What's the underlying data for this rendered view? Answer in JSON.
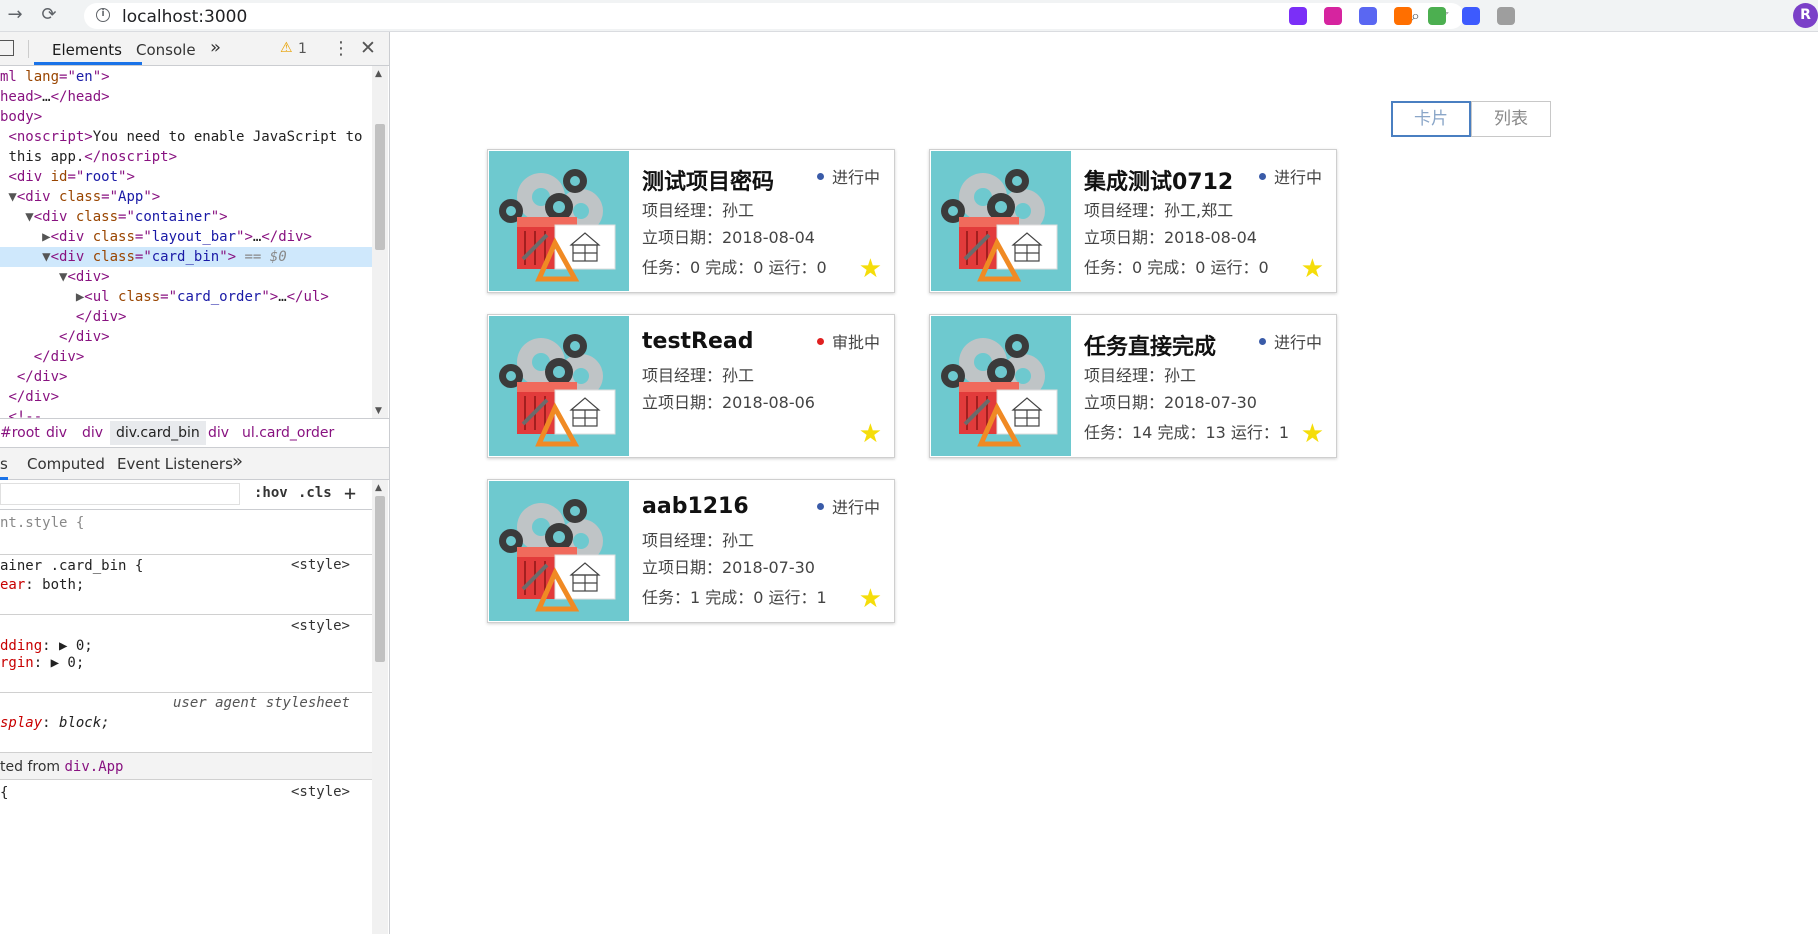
{
  "browser": {
    "url": "localhost:3000",
    "profile_initial": "R",
    "extension_colors": [
      "#7b2ff7",
      "#d6249f",
      "#5a67f2",
      "#ff6f00",
      "#4caf50",
      "#3d5afe",
      "#9e9e9e"
    ]
  },
  "devtools": {
    "tabs": [
      "Elements",
      "Console"
    ],
    "more_tabs": "»",
    "warning_count": "1",
    "tree": [
      {
        "indent": "",
        "tri": "",
        "parts": [
          [
            "tag",
            "ml "
          ],
          [
            "attr",
            "lang"
          ],
          [
            "tag",
            "=\""
          ],
          [
            "val",
            "en"
          ],
          [
            "tag",
            "\">"
          ]
        ]
      },
      {
        "indent": "",
        "tri": "",
        "parts": [
          [
            "tag",
            "head>"
          ],
          [
            "text",
            "…"
          ],
          [
            "tag",
            "</head>"
          ]
        ]
      },
      {
        "indent": "",
        "tri": "",
        "parts": [
          [
            "tag",
            "body>"
          ]
        ]
      },
      {
        "indent": " ",
        "tri": "",
        "parts": [
          [
            "tag",
            "<noscript>"
          ],
          [
            "text",
            "You need to enable JavaScript to run"
          ]
        ]
      },
      {
        "indent": " ",
        "tri": "",
        "parts": [
          [
            "text",
            "this app."
          ],
          [
            "tag",
            "</noscript>"
          ]
        ]
      },
      {
        "indent": " ",
        "tri": "",
        "parts": [
          [
            "tag",
            "<div "
          ],
          [
            "attr",
            "id"
          ],
          [
            "tag",
            "=\""
          ],
          [
            "val",
            "root"
          ],
          [
            "tag",
            "\">"
          ]
        ]
      },
      {
        "indent": "",
        "tri": " ▼",
        "parts": [
          [
            "tag",
            "<div "
          ],
          [
            "attr",
            "class"
          ],
          [
            "tag",
            "=\""
          ],
          [
            "val",
            "App"
          ],
          [
            "tag",
            "\">"
          ]
        ]
      },
      {
        "indent": "  ",
        "tri": " ▼",
        "parts": [
          [
            "tag",
            "<div "
          ],
          [
            "attr",
            "class"
          ],
          [
            "tag",
            "=\""
          ],
          [
            "val",
            "container"
          ],
          [
            "tag",
            "\">"
          ]
        ]
      },
      {
        "indent": "    ",
        "tri": " ▶",
        "parts": [
          [
            "tag",
            "<div "
          ],
          [
            "attr",
            "class"
          ],
          [
            "tag",
            "=\""
          ],
          [
            "val",
            "layout_bar"
          ],
          [
            "tag",
            "\">"
          ],
          [
            "text",
            "…"
          ],
          [
            "tag",
            "</div>"
          ]
        ]
      },
      {
        "indent": "    ",
        "tri": " ▼",
        "parts": [
          [
            "tag",
            "<div "
          ],
          [
            "attr",
            "class"
          ],
          [
            "tag",
            "=\""
          ],
          [
            "val",
            "card_bin"
          ],
          [
            "tag",
            "\">"
          ],
          [
            "eq",
            " == $0"
          ]
        ],
        "selected": true
      },
      {
        "indent": "      ",
        "tri": " ▼",
        "parts": [
          [
            "tag",
            "<div>"
          ]
        ]
      },
      {
        "indent": "        ",
        "tri": " ▶",
        "parts": [
          [
            "tag",
            "<ul "
          ],
          [
            "attr",
            "class"
          ],
          [
            "tag",
            "=\""
          ],
          [
            "val",
            "card_order"
          ],
          [
            "tag",
            "\">"
          ],
          [
            "text",
            "…"
          ],
          [
            "tag",
            "</ul>"
          ]
        ]
      },
      {
        "indent": "         ",
        "tri": "",
        "parts": [
          [
            "tag",
            "</div>"
          ]
        ]
      },
      {
        "indent": "       ",
        "tri": "",
        "parts": [
          [
            "tag",
            "</div>"
          ]
        ]
      },
      {
        "indent": "    ",
        "tri": "",
        "parts": [
          [
            "tag",
            "</div>"
          ]
        ]
      },
      {
        "indent": "  ",
        "tri": "",
        "parts": [
          [
            "tag",
            "</div>"
          ]
        ]
      },
      {
        "indent": " ",
        "tri": "",
        "parts": [
          [
            "tag",
            "</div>"
          ]
        ]
      },
      {
        "indent": " ",
        "tri": "",
        "parts": [
          [
            "tag",
            "<!--"
          ]
        ]
      }
    ],
    "breadcrumbs": [
      "#root",
      "div",
      "div",
      "div.card_bin",
      "div",
      "ul.card_order"
    ],
    "styles_tabs": [
      "s",
      "Computed",
      "Event Listeners"
    ],
    "styles_more": "»",
    "filter_hov": ":hov",
    "filter_cls": ".cls",
    "filter_add": "+",
    "rules": [
      {
        "selector": "nt.style {",
        "source": ""
      },
      {
        "selector": "ainer .card_bin {",
        "source": "<style>",
        "props": [
          [
            "ear",
            "both;"
          ]
        ]
      },
      {
        "selector": "",
        "source": "<style>",
        "props": [
          [
            "dding",
            "▶ 0;"
          ],
          [
            "rgin",
            "▶ 0;"
          ]
        ]
      },
      {
        "selector": "",
        "source": "user agent stylesheet",
        "props": [
          [
            "splay",
            "block;"
          ]
        ]
      }
    ],
    "inherited_label": "ted from",
    "inherited_from": "div.App",
    "last_rule_selector": "{",
    "last_rule_source": "<style>"
  },
  "page": {
    "toggle": {
      "card_label": "卡片",
      "list_label": "列表",
      "active": "card"
    },
    "status_colors": {
      "进行中": "#3a5ba8",
      "审批中": "#e02020"
    },
    "cards": [
      {
        "title": "测试项目密码",
        "status": "进行中",
        "manager": "项目经理：孙工",
        "date": "立项日期：2018-08-04",
        "tasks": "任务：0 完成：0 运行：0"
      },
      {
        "title": "集成测试0712",
        "status": "进行中",
        "manager": "项目经理：孙工,郑工",
        "date": "立项日期：2018-08-04",
        "tasks": "任务：0 完成：0 运行：0"
      },
      {
        "title": "testRead",
        "status": "审批中",
        "manager": "项目经理：孙工",
        "date": "立项日期：2018-08-06",
        "tasks": ""
      },
      {
        "title": "任务直接完成",
        "status": "进行中",
        "manager": "项目经理：孙工",
        "date": "立项日期：2018-07-30",
        "tasks": "任务：14 完成：13 运行：1"
      },
      {
        "title": "aab1216",
        "status": "进行中",
        "manager": "项目经理：孙工",
        "date": "立项日期：2018-07-30",
        "tasks": "任务：1 完成：0 运行：1"
      }
    ]
  }
}
